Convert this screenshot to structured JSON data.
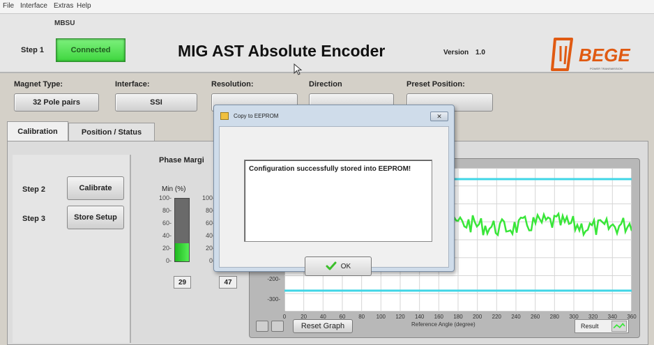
{
  "menu": {
    "items": [
      "File",
      "Interface",
      "Extras",
      "Help"
    ]
  },
  "header": {
    "device_label": "MBSU",
    "step1_label": "Step 1",
    "connection_status": "Connected",
    "title": "MIG AST Absolute Encoder",
    "version_label": "Version",
    "version_value": "1.0",
    "logo_text": "BEGE",
    "logo_subtext": "POWER TRANSMISSION"
  },
  "config": {
    "magnet_type_label": "Magnet Type:",
    "magnet_type_value": "32 Pole pairs",
    "interface_label": "Interface:",
    "interface_value": "SSI",
    "resolution_label": "Resolution:",
    "resolution_value": "",
    "direction_label": "Direction",
    "direction_value": "",
    "preset_label": "Preset Position:",
    "preset_value": ""
  },
  "tabs": [
    {
      "label": "Calibration",
      "active": true
    },
    {
      "label": "Position / Status",
      "active": false
    }
  ],
  "calibration": {
    "step2_label": "Step 2",
    "calibrate_button": "Calibrate",
    "step3_label": "Step 3",
    "store_button": "Store Setup",
    "phase_title": "Phase Margi",
    "min_label": "Min (%)",
    "scale_ticks": [
      "100-",
      "80-",
      "60-",
      "40-",
      "20-",
      "0-"
    ],
    "min_value": "29",
    "second_value": "47",
    "min_fraction": 0.29,
    "second_fraction": 0.47
  },
  "graph": {
    "y_ticks": [
      "-200-",
      "-300-"
    ],
    "x_ticks": [
      "0",
      "20",
      "40",
      "60",
      "80",
      "100",
      "120",
      "140",
      "160",
      "180",
      "200",
      "220",
      "240",
      "260",
      "280",
      "300",
      "320",
      "340",
      "360"
    ],
    "x_axis_label": "Reference Angle (degree)",
    "reset_button": "Reset Graph",
    "result_label": "Result",
    "series_color": "#39e639",
    "limit_color": "#3fd6e6"
  },
  "dialog": {
    "title": "Copy to EEPROM",
    "close_label": "✕",
    "message": "Configuration successfully stored into EEPROM!",
    "ok_label": "OK"
  }
}
